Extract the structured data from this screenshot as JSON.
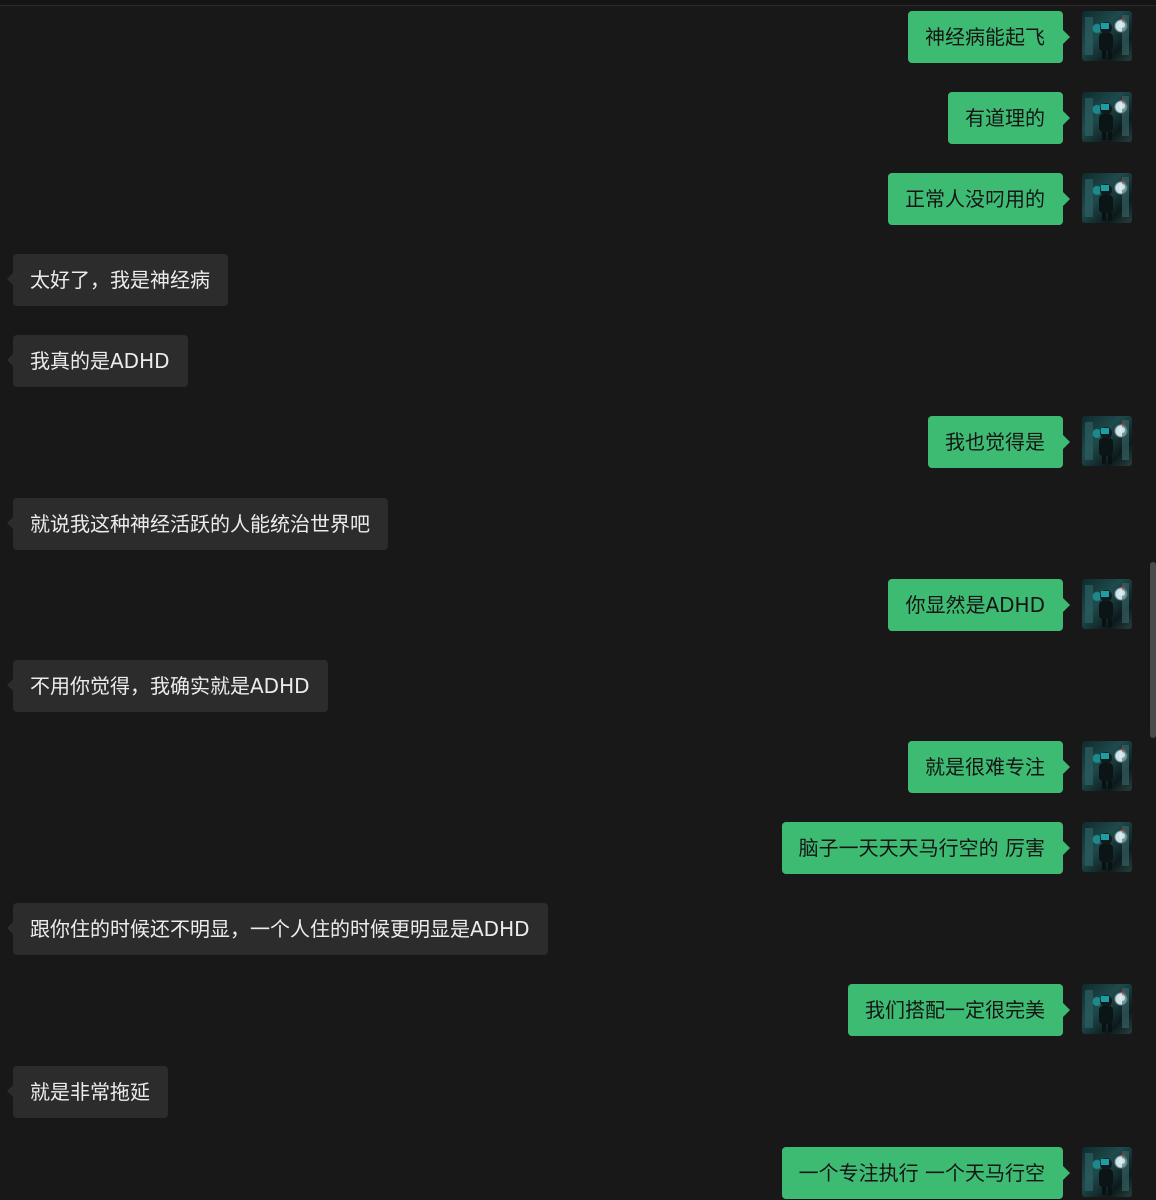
{
  "messages": [
    {
      "side": "mine",
      "text": "神经病能起飞"
    },
    {
      "side": "mine",
      "text": "有道理的"
    },
    {
      "side": "mine",
      "text": "正常人没叼用的"
    },
    {
      "side": "theirs",
      "text": "太好了，我是神经病"
    },
    {
      "side": "theirs",
      "text": "我真的是ADHD"
    },
    {
      "side": "mine",
      "text": "我也觉得是"
    },
    {
      "side": "theirs",
      "text": "就说我这种神经活跃的人能统治世界吧"
    },
    {
      "side": "mine",
      "text": "你显然是ADHD"
    },
    {
      "side": "theirs",
      "text": "不用你觉得，我确实就是ADHD"
    },
    {
      "side": "mine",
      "text": "就是很难专注"
    },
    {
      "side": "mine",
      "text": "脑子一天天天马行空的 厉害"
    },
    {
      "side": "theirs",
      "text": "跟你住的时候还不明显，一个人住的时候更明显是ADHD"
    },
    {
      "side": "mine",
      "text": "我们搭配一定很完美"
    },
    {
      "side": "theirs",
      "text": "就是非常拖延"
    },
    {
      "side": "mine",
      "text": "一个专注执行 一个天马行空"
    }
  ],
  "avatar_icon": "user-avatar-photo",
  "colors": {
    "background": "#181818",
    "mine_bubble": "#3dbb73",
    "theirs_bubble": "#2c2c2c",
    "mine_text": "#151515",
    "theirs_text": "#ececec"
  }
}
